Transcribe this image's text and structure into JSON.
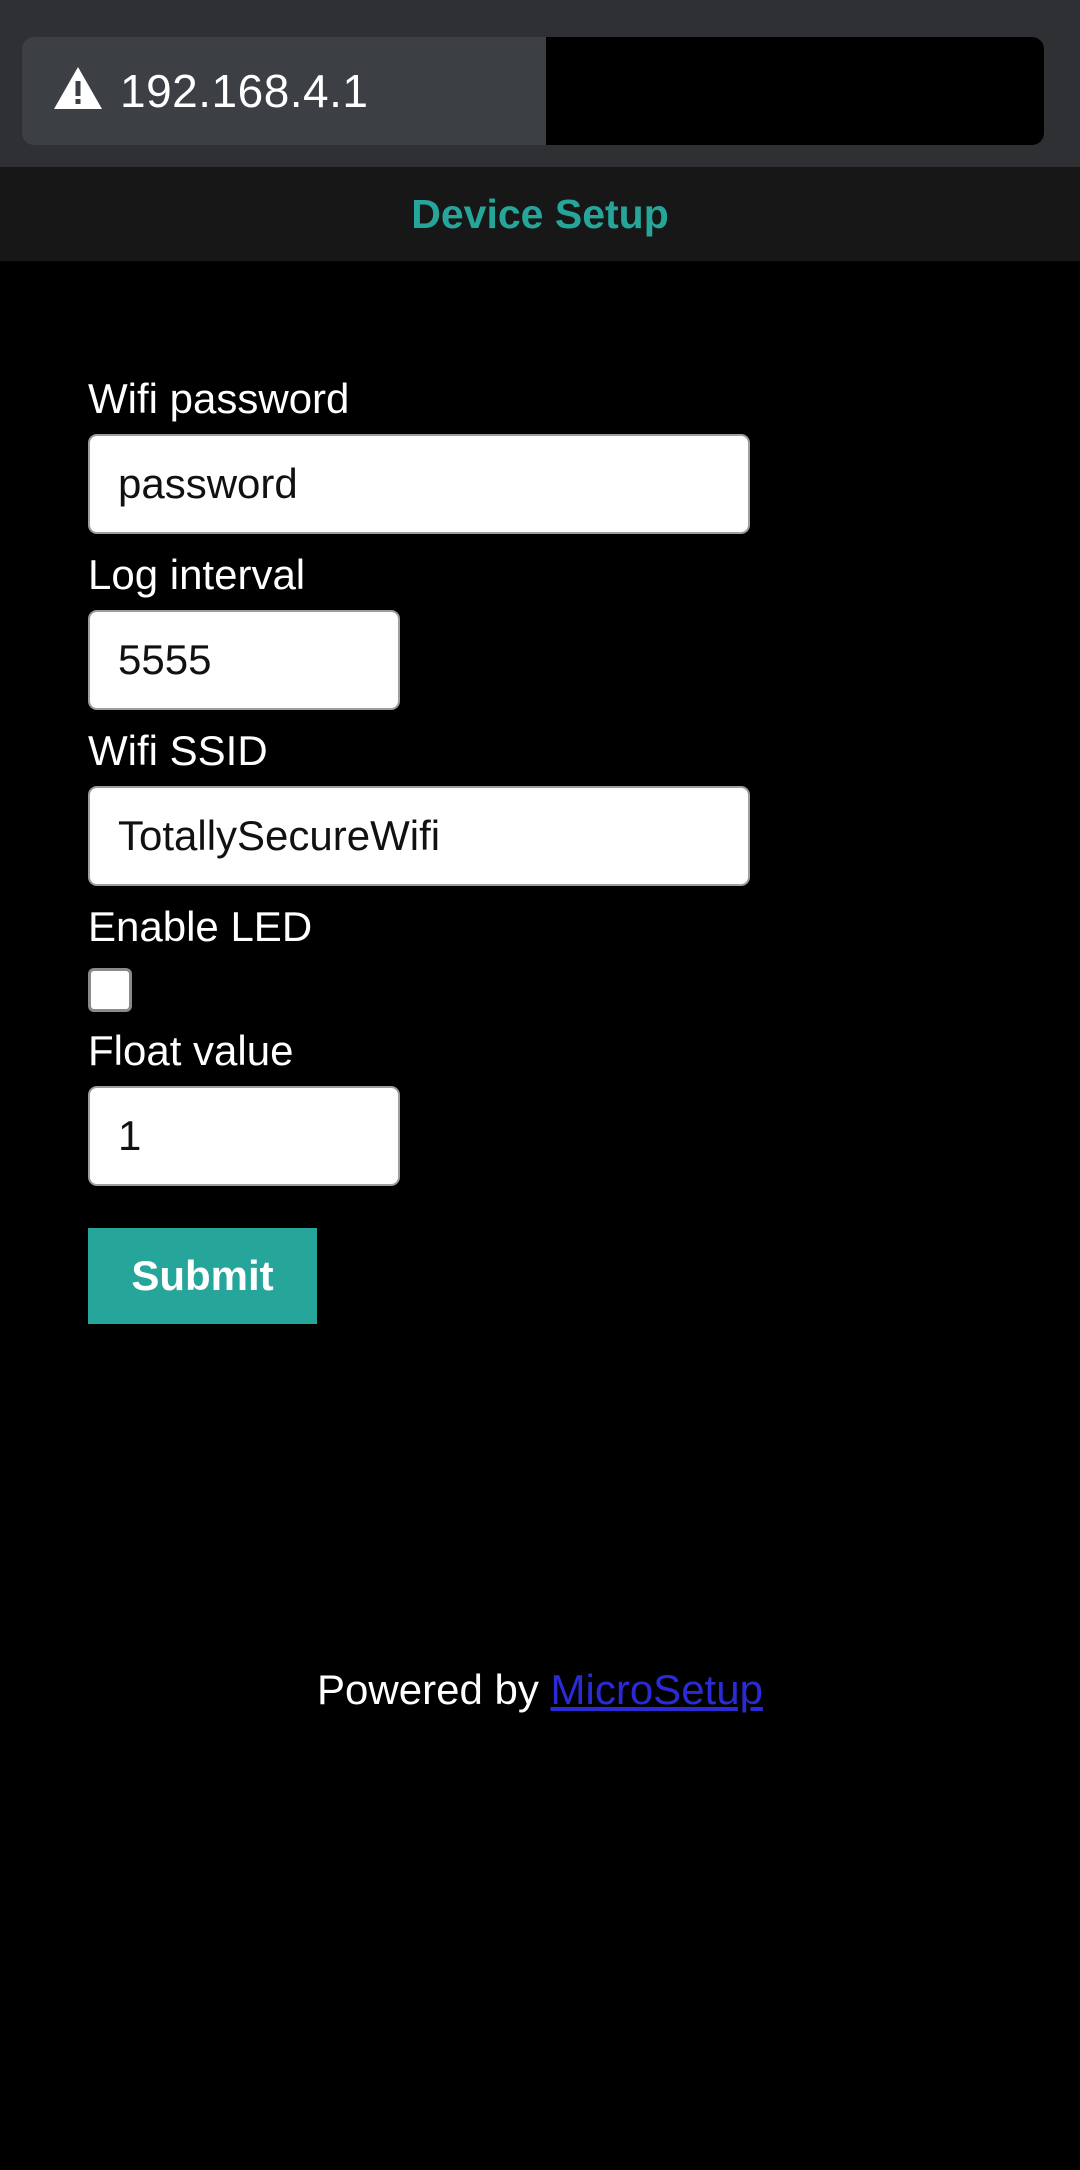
{
  "browser": {
    "url": "192.168.4.1",
    "warning_icon": "warning-triangle-icon"
  },
  "header": {
    "title": "Device Setup",
    "accent_color": "#26a69a"
  },
  "form": {
    "wifi_password": {
      "label": "Wifi password",
      "value": "password"
    },
    "log_interval": {
      "label": "Log interval",
      "value": "5555"
    },
    "wifi_ssid": {
      "label": "Wifi SSID",
      "value": "TotallySecureWifi"
    },
    "enable_led": {
      "label": "Enable LED",
      "checked": false
    },
    "float_value": {
      "label": "Float value",
      "value": "1"
    },
    "submit_label": "Submit"
  },
  "footer": {
    "prefix": "Powered by",
    "link_text": "MicroSetup"
  }
}
